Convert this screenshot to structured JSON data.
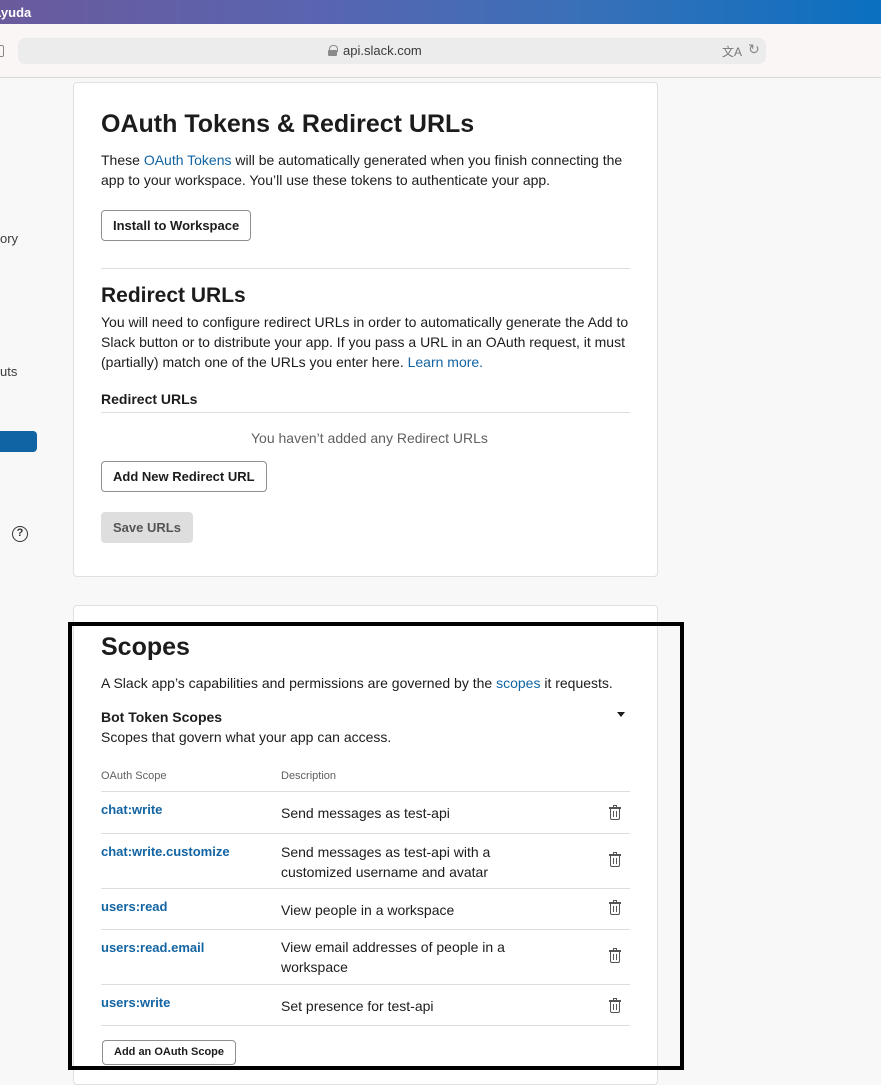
{
  "menubar": {
    "app_menu": "Ayuda"
  },
  "browser": {
    "url": "api.slack.com",
    "translate_icon": "translate-icon",
    "reload_icon": "reload-icon"
  },
  "sidebar": {
    "items": [
      {
        "label": "ory"
      },
      {
        "label": "uts"
      }
    ],
    "help_icon": "?"
  },
  "oauth_card": {
    "title": "OAuth Tokens & Redirect URLs",
    "intro_prefix": "These ",
    "intro_link": "OAuth Tokens",
    "intro_suffix_line1": " will be automatically generated when you finish connecting the",
    "intro_line2": "app to your workspace. You’ll use these tokens to authenticate your app.",
    "install_button": "Install to Workspace",
    "redirect_title": "Redirect URLs",
    "redirect_desc_line1": "You will need to configure redirect URLs in order to automatically generate the Add to",
    "redirect_desc_line2": "Slack button or to distribute your app. If you pass a URL in an OAuth request, it must",
    "redirect_desc_line3": "(partially) match one of the URLs you enter here. ",
    "redirect_learn_more": "Learn more.",
    "redirect_urls_label": "Redirect URLs",
    "empty_text": "You haven’t added any Redirect URLs",
    "add_button": "Add New Redirect URL",
    "save_button": "Save URLs"
  },
  "scopes_card": {
    "title": "Scopes",
    "desc_prefix": "A Slack app’s capabilities and permissions are governed by the ",
    "desc_link": "scopes",
    "desc_suffix": " it requests.",
    "bot_title": "Bot Token Scopes",
    "bot_desc": "Scopes that govern what your app can access.",
    "columns": [
      "OAuth Scope",
      "Description"
    ],
    "rows": [
      {
        "scope": "chat:write",
        "desc_lines": [
          "Send messages as test-api"
        ]
      },
      {
        "scope": "chat:write.customize",
        "desc_lines": [
          "Send messages as test-api with a",
          "customized username and avatar"
        ]
      },
      {
        "scope": "users:read",
        "desc_lines": [
          "View people in a workspace"
        ]
      },
      {
        "scope": "users:read.email",
        "desc_lines": [
          "View email addresses of people in a",
          "workspace"
        ]
      },
      {
        "scope": "users:write",
        "desc_lines": [
          "Set presence for test-api"
        ]
      }
    ],
    "add_scope_button": "Add an OAuth Scope"
  }
}
